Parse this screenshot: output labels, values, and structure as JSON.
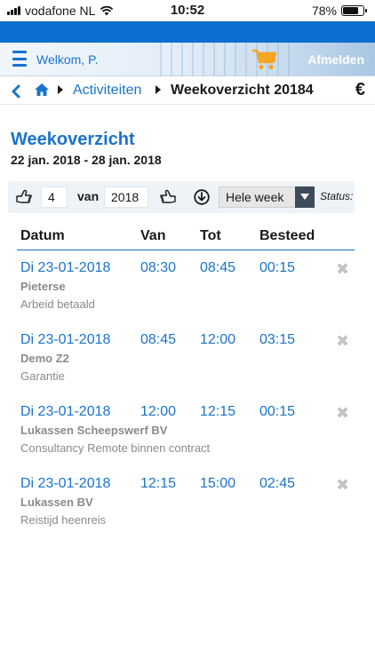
{
  "statusbar": {
    "carrier": "vodafone NL",
    "time": "10:52",
    "battery": "78%",
    "battery_level": 0.78
  },
  "header": {
    "welcome": "Welkom, P.",
    "logout": "Afmelden",
    "cart_icon": "cart-icon",
    "menu_icon": "menu-icon"
  },
  "breadcrumb": {
    "back": "‹",
    "parent": "Activiteiten",
    "current": "Weekoverzicht 20184",
    "currency": "€"
  },
  "page": {
    "title": "Weekoverzicht",
    "date_range": "22 jan. 2018 - 28 jan. 2018"
  },
  "filter": {
    "week": "4",
    "van_label": "van",
    "year": "2018",
    "period": "Hele week",
    "status_label": "Status:"
  },
  "table": {
    "headers": [
      "Datum",
      "Van",
      "Tot",
      "Besteed"
    ],
    "rows": [
      {
        "date": "Di 23-01-2018",
        "from": "08:30",
        "to": "08:45",
        "spent": "00:15",
        "client": "Pieterse",
        "activity": "Arbeid betaald"
      },
      {
        "date": "Di 23-01-2018",
        "from": "08:45",
        "to": "12:00",
        "spent": "03:15",
        "client": "Demo Z2",
        "activity": "Garantie"
      },
      {
        "date": "Di 23-01-2018",
        "from": "12:00",
        "to": "12:15",
        "spent": "00:15",
        "client": "Lukassen Scheepswerf BV",
        "activity": "Consultancy Remote binnen contract"
      },
      {
        "date": "Di 23-01-2018",
        "from": "12:15",
        "to": "15:00",
        "spent": "02:45",
        "client": "Lukassen BV",
        "activity": "Reistijd heenreis"
      }
    ]
  },
  "colors": {
    "accent": "#1b73c9",
    "topstrip": "#0a6fcf",
    "muted": "#8a8a8a",
    "cart": "#f5a623"
  }
}
